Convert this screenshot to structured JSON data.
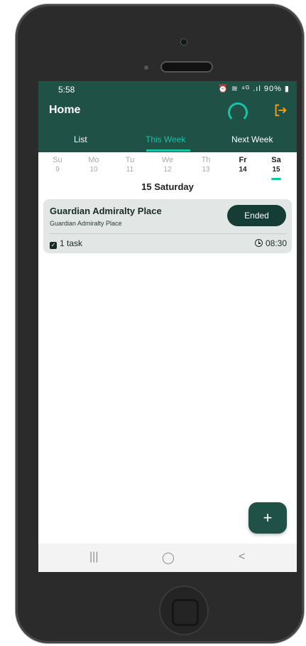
{
  "status_bar": {
    "time": "5:58",
    "icons": "⏰ ≋ ⁴ᴳ .ıl 90% ▮"
  },
  "header": {
    "title": "Home"
  },
  "tabs": [
    {
      "label": "List",
      "active": false
    },
    {
      "label": "This Week",
      "active": true
    },
    {
      "label": "Next Week",
      "active": false
    }
  ],
  "week_days": [
    {
      "name": "Su",
      "num": "9"
    },
    {
      "name": "Mo",
      "num": "10"
    },
    {
      "name": "Tu",
      "num": "11"
    },
    {
      "name": "We",
      "num": "12"
    },
    {
      "name": "Th",
      "num": "13"
    },
    {
      "name": "Fr",
      "num": "14"
    },
    {
      "name": "Sa",
      "num": "15"
    }
  ],
  "date_heading": "15 Saturday",
  "event_card": {
    "title": "Guardian Admiralty Place",
    "subtitle": "Guardian Admiralty Place",
    "status": "Ended",
    "task_count": "1 task",
    "time": "08:30"
  },
  "fab": {
    "label": "+"
  },
  "nav_bar": {
    "recent": "|||",
    "home": "◯",
    "back": "<"
  },
  "colors": {
    "primary": "#1f5147",
    "accent": "#19c1a6",
    "logout_icon": "#f2a21b",
    "card_bg": "#e2e7e5"
  }
}
